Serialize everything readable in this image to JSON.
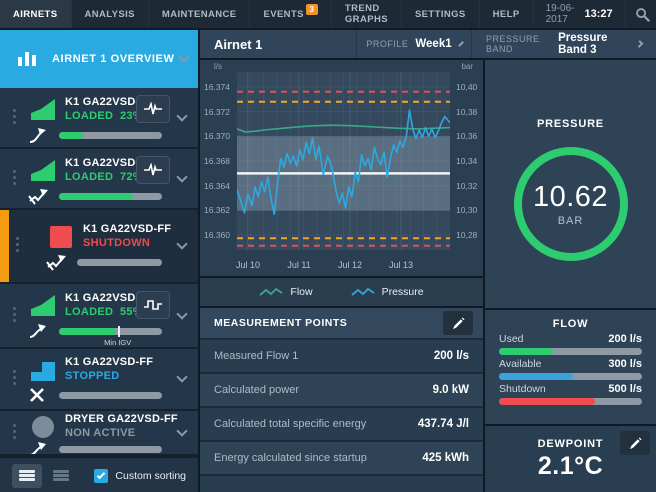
{
  "topnav": {
    "items": [
      {
        "label": "AIRNETS",
        "active": true
      },
      {
        "label": "ANALYSIS"
      },
      {
        "label": "MAINTENANCE"
      },
      {
        "label": "EVENTS",
        "badge": "3"
      },
      {
        "label": "TREND GRAPHS"
      },
      {
        "label": "SETTINGS"
      },
      {
        "label": "HELP"
      }
    ],
    "date": "19-06-2017",
    "time": "13:27",
    "search_icon": "search-icon"
  },
  "sidebar": {
    "overview_label": "AIRNET 1 OVERVIEW",
    "items": [
      {
        "name": "K1 GA22VSD-FF",
        "status": "LOADED",
        "percent": "23%",
        "progress": 23,
        "status_color": "#2ecc71",
        "icon": "wedge-up-icon",
        "icon_color": "#2ecc71",
        "sub_icon": "curved-arrow-icon",
        "pulse_button": "heartbeat"
      },
      {
        "name": "K1 GA22VSD-FF",
        "status": "LOADED",
        "percent": "72%",
        "progress": 72,
        "status_color": "#2ecc71",
        "icon": "wedge-up-icon",
        "icon_color": "#2ecc71",
        "sub_icon": "restricted-arrow-icon",
        "pulse_button": "heartbeat"
      },
      {
        "name": "K1 GA22VSD-FF",
        "status": "SHUTDOWN",
        "percent": "",
        "progress": 0,
        "status_color": "#f04b4f",
        "icon": "square-icon",
        "icon_color": "#f04b4f",
        "sub_icon": "restricted-arrow-icon",
        "flagged": true
      },
      {
        "name": "K1 GA22VSD-FF",
        "status": "LOADED",
        "percent": "55%",
        "progress": 55,
        "status_color": "#2ecc71",
        "icon": "wedge-up-icon",
        "icon_color": "#2ecc71",
        "sub_icon": "rising-arrow-icon",
        "pulse_button": "square-wave",
        "marker_percent": 57,
        "marker_label": "Min IGV"
      },
      {
        "name": "K1 GA22VSD-FF",
        "status": "STOPPED",
        "percent": "",
        "progress": 0,
        "status_color": "#29abe2",
        "icon": "step-up-icon",
        "icon_color": "#29abe2",
        "sub_icon": "x-icon"
      },
      {
        "name": "DRYER GA22VSD-FF",
        "status": "NON ACTIVE",
        "percent": "",
        "progress": 0,
        "status_color": "#8a9aa8",
        "icon": "circle-icon",
        "icon_color": "#7d8c9b",
        "sub_icon": "curved-arrow-icon"
      }
    ],
    "footer": {
      "custom_sorting_label": "Custom sorting",
      "custom_sorting_checked": true
    }
  },
  "header": {
    "title": "Airnet 1",
    "profile_label": "PROFILE",
    "profile_value": "Week1",
    "pressure_band_label": "PRESSURE BAND",
    "pressure_band_value": "Pressure Band 3"
  },
  "chart_data": {
    "type": "line",
    "y_left_unit": "l/s",
    "y_right_unit": "bar",
    "y_left_labels": [
      "16.374",
      "16.372",
      "16.370",
      "16.368",
      "16.364",
      "16.362",
      "16.360"
    ],
    "y_right_labels": [
      "10,40",
      "10,38",
      "10,36",
      "10,34",
      "10,32",
      "10,30",
      "10,28"
    ],
    "y_ticks_bar": [
      10.4,
      10.38,
      10.36,
      10.34,
      10.32,
      10.3,
      10.28
    ],
    "y_range": [
      10.268,
      10.412
    ],
    "x_tick_labels": [
      "Jul 10",
      "Jul 11",
      "Jul 12",
      "Jul 13"
    ],
    "x_tick_fractions": [
      0.05,
      0.29,
      0.53,
      0.77
    ],
    "x_minor_divisions": 16,
    "band": {
      "from": 10.3,
      "to": 10.36,
      "color": "rgba(150,170,188,0.38)"
    },
    "setpoint_bar": 10.33,
    "limit_lines": [
      {
        "value": 10.396,
        "color": "#e05252"
      },
      {
        "value": 10.388,
        "color": "#f5a623"
      },
      {
        "value": 10.2775,
        "color": "#f5a623"
      },
      {
        "value": 10.2715,
        "color": "#e05252"
      }
    ],
    "series": [
      {
        "name": "Flow",
        "color": "#3aa98a",
        "points": [
          [
            0,
            10.366
          ],
          [
            0.04,
            10.3635
          ],
          [
            0.08,
            10.364
          ],
          [
            0.15,
            10.3655
          ],
          [
            0.25,
            10.367
          ],
          [
            0.35,
            10.3685
          ],
          [
            0.45,
            10.369
          ],
          [
            0.55,
            10.3685
          ],
          [
            0.65,
            10.3675
          ],
          [
            0.75,
            10.3665
          ],
          [
            0.85,
            10.366
          ],
          [
            0.93,
            10.3665
          ],
          [
            1,
            10.367
          ]
        ]
      },
      {
        "name": "Pressure",
        "color": "#2da9e0",
        "points": [
          [
            0,
            10.317
          ],
          [
            0.02,
            10.306
          ],
          [
            0.035,
            10.298
          ],
          [
            0.05,
            10.313
          ],
          [
            0.07,
            10.304
          ],
          [
            0.085,
            10.319
          ],
          [
            0.1,
            10.311
          ],
          [
            0.115,
            10.323
          ],
          [
            0.13,
            10.315
          ],
          [
            0.145,
            10.327
          ],
          [
            0.16,
            10.309
          ],
          [
            0.175,
            10.297
          ],
          [
            0.19,
            10.322
          ],
          [
            0.205,
            10.342
          ],
          [
            0.22,
            10.335
          ],
          [
            0.235,
            10.346
          ],
          [
            0.25,
            10.338
          ],
          [
            0.265,
            10.344
          ],
          [
            0.28,
            10.336
          ],
          [
            0.295,
            10.349
          ],
          [
            0.31,
            10.341
          ],
          [
            0.325,
            10.355
          ],
          [
            0.34,
            10.346
          ],
          [
            0.355,
            10.359
          ],
          [
            0.37,
            10.341
          ],
          [
            0.385,
            10.352
          ],
          [
            0.405,
            10.329
          ],
          [
            0.425,
            10.344
          ],
          [
            0.445,
            10.335
          ],
          [
            0.465,
            10.316
          ],
          [
            0.48,
            10.306
          ],
          [
            0.495,
            10.314
          ],
          [
            0.51,
            10.302
          ],
          [
            0.525,
            10.319
          ],
          [
            0.54,
            10.311
          ],
          [
            0.555,
            10.331
          ],
          [
            0.57,
            10.323
          ],
          [
            0.585,
            10.345
          ],
          [
            0.6,
            10.336
          ],
          [
            0.615,
            10.342
          ],
          [
            0.63,
            10.333
          ],
          [
            0.645,
            10.351
          ],
          [
            0.66,
            10.342
          ],
          [
            0.675,
            10.337
          ],
          [
            0.69,
            10.347
          ],
          [
            0.705,
            10.327
          ],
          [
            0.72,
            10.342
          ],
          [
            0.735,
            10.353
          ],
          [
            0.75,
            10.347
          ],
          [
            0.765,
            10.356
          ],
          [
            0.78,
            10.351
          ],
          [
            0.795,
            10.36
          ],
          [
            0.81,
            10.381
          ],
          [
            0.825,
            10.366
          ],
          [
            0.84,
            10.358
          ],
          [
            0.855,
            10.365
          ],
          [
            0.87,
            10.359
          ],
          [
            0.885,
            10.367
          ],
          [
            0.9,
            10.36
          ],
          [
            0.915,
            10.366
          ],
          [
            0.93,
            10.359
          ],
          [
            0.945,
            10.364
          ],
          [
            0.96,
            10.371
          ],
          [
            0.975,
            10.376
          ],
          [
            1,
            10.371
          ]
        ]
      }
    ]
  },
  "legend": {
    "items": [
      {
        "label": "Flow",
        "color": "#3aa98a"
      },
      {
        "label": "Pressure",
        "color": "#2da9e0"
      }
    ]
  },
  "measurement_points": {
    "title": "MEASUREMENT POINTS",
    "rows": [
      {
        "label": "Measured Flow 1",
        "value": "200 l/s"
      },
      {
        "label": "Calculated power",
        "value": "9.0 kW"
      },
      {
        "label": "Calculated total specific energy",
        "value": "437.74 J/l"
      },
      {
        "label": "Energy calculated since startup",
        "value": "425 kWh"
      }
    ]
  },
  "right_panel": {
    "pressure": {
      "title": "PRESSURE",
      "value": "10.62",
      "unit": "BAR",
      "ring_color": "#2ecc71"
    },
    "flow": {
      "title": "FLOW",
      "bars": [
        {
          "label": "Used",
          "value": "200 l/s",
          "percent": 38,
          "color": "#2ecc71"
        },
        {
          "label": "Available",
          "value": "300 l/s",
          "percent": 52,
          "color": "#3ba3dc"
        },
        {
          "label": "Shutdown",
          "value": "500 l/s",
          "percent": 67,
          "color": "#f04b4f"
        }
      ]
    },
    "dewpoint": {
      "title": "DEWPOINT",
      "value": "2.1°C"
    }
  }
}
